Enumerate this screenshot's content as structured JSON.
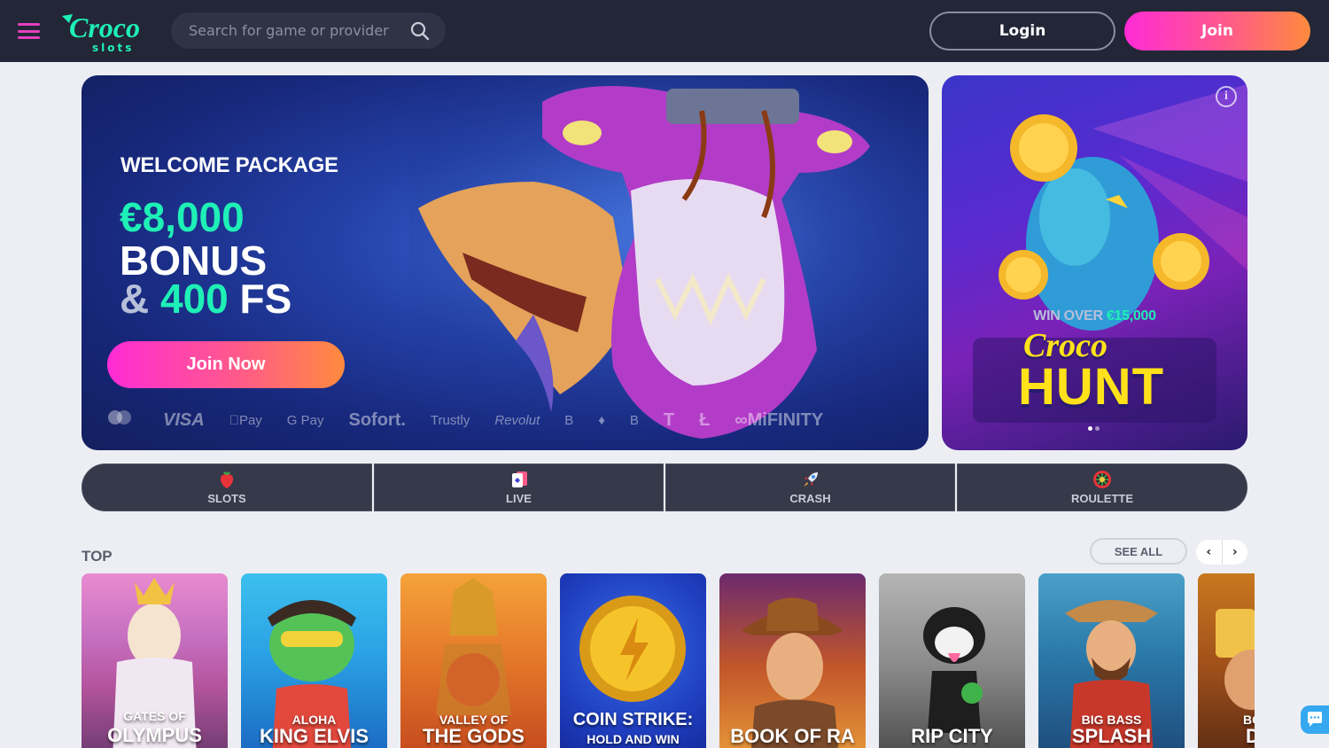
{
  "header": {
    "logo_text": "Croco",
    "logo_sub": "slots",
    "search_placeholder": "Search for game or provider",
    "login_label": "Login",
    "join_label": "Join"
  },
  "hero": {
    "title": "WELCOME PACKAGE",
    "amount": "€8,000",
    "bonus": "BONUS",
    "amp": "&",
    "fs_num": "400",
    "fs_unit": "FS",
    "cta": "Join Now",
    "payments": [
      "VISA",
      "Pay",
      "G Pay",
      "Sofort.",
      "Trustly",
      "Revolut",
      "B",
      "T",
      "Ł",
      "MiFINITY"
    ]
  },
  "promo": {
    "win_prefix": "WIN OVER",
    "win_value": "€15,000",
    "brand": "Croco",
    "name": "HUNT"
  },
  "categories": [
    {
      "label": "SLOTS",
      "icon": "strawberry-icon"
    },
    {
      "label": "LIVE",
      "icon": "playing-card-icon"
    },
    {
      "label": "CRASH",
      "icon": "rocket-icon"
    },
    {
      "label": "ROULETTE",
      "icon": "roulette-icon"
    }
  ],
  "top": {
    "title": "TOP",
    "see_all": "SEE ALL",
    "prev": "‹",
    "next": "›",
    "games": [
      {
        "line1": "GATES OF",
        "line2": "OLYMPUS"
      },
      {
        "line1": "ALOHA",
        "line2": "KING ELVIS"
      },
      {
        "line1": "VALLEY OF",
        "line2": "THE GODS"
      },
      {
        "line1": "COIN STRIKE:",
        "line2": "HOLD AND WIN"
      },
      {
        "line1": "",
        "line2": "BOOK OF RA"
      },
      {
        "line1": "",
        "line2": "RIP CITY"
      },
      {
        "line1": "BIG BASS",
        "line2": "SPLASH"
      },
      {
        "line1": "BO",
        "line2": "D"
      }
    ]
  },
  "colors": {
    "accent_pink": "#ff2bd6",
    "accent_orange": "#ff8a3d",
    "accent_green": "#1ef0b6",
    "header_bg": "#232637",
    "page_bg": "#eceef3"
  }
}
